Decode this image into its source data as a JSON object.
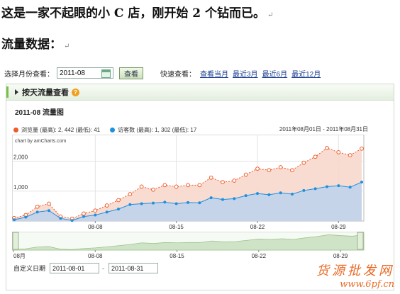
{
  "doc": {
    "line1": "这是一家不起眼的小 C 店，刚开始 2 个钻而已。",
    "line2": "流量数据：",
    "return_mark": "↵"
  },
  "toolbar": {
    "month_label": "选择月份查看：",
    "month_value": "2011-08",
    "view_button": "查看",
    "quick_label": "快速查看：",
    "quick_links": [
      "查看当月",
      "最近3月",
      "最近6月",
      "最近12月"
    ]
  },
  "panel": {
    "title": "按天流量查看",
    "help": "?",
    "chart_title": "2011-08 流量图",
    "legend": {
      "pv": "浏览量 (最高): 2, 442 (最低): 41",
      "uv": "访客数 (最高): 1, 302 (最低): 17",
      "range": "2011年08月01日 - 2011年08月31日"
    },
    "credit": "chart by amCharts.com",
    "custom_date_label": "自定义日期",
    "date_from": "2011-08-01",
    "date_sep": "-",
    "date_to": "2011-08-31"
  },
  "watermark": {
    "line1": "货源批发网",
    "line2": "www.6pf.cn"
  },
  "colors": {
    "pv": "#f05a28",
    "pv_fill": "#f7d8cc",
    "uv": "#1e90e0",
    "uv_fill": "#c6d4ea",
    "accent": "#7cbf49"
  },
  "chart_data": {
    "type": "area",
    "x": [
      "08-01",
      "08-02",
      "08-03",
      "08-04",
      "08-05",
      "08-06",
      "08-07",
      "08-08",
      "08-09",
      "08-10",
      "08-11",
      "08-12",
      "08-13",
      "08-14",
      "08-15",
      "08-16",
      "08-17",
      "08-18",
      "08-19",
      "08-20",
      "08-21",
      "08-22",
      "08-23",
      "08-24",
      "08-25",
      "08-26",
      "08-27",
      "08-28",
      "08-29",
      "08-30",
      "08-31"
    ],
    "x_ticks": [
      "08-08",
      "08-15",
      "08-22",
      "08-29"
    ],
    "nav_ticks": [
      "08月",
      "08-08",
      "08-15",
      "08-22",
      "08-29"
    ],
    "y_ticks": [
      1000,
      2000
    ],
    "y_tick_labels": [
      "1,000",
      "2,000"
    ],
    "ylim": [
      0,
      2700
    ],
    "series": [
      {
        "name": "浏览量",
        "values": [
          100,
          200,
          480,
          580,
          150,
          80,
          250,
          350,
          520,
          700,
          900,
          1150,
          1050,
          1200,
          1150,
          1200,
          1200,
          1450,
          1300,
          1350,
          1550,
          1750,
          1700,
          1800,
          1700,
          1950,
          2150,
          2442,
          2300,
          2200,
          2420
        ]
      },
      {
        "name": "访客数",
        "values": [
          41,
          130,
          300,
          350,
          90,
          17,
          150,
          200,
          300,
          400,
          550,
          580,
          600,
          630,
          580,
          620,
          610,
          780,
          720,
          750,
          850,
          920,
          880,
          940,
          900,
          1020,
          1080,
          1150,
          1180,
          1130,
          1302
        ]
      }
    ],
    "grid": true,
    "legend_position": "top"
  }
}
